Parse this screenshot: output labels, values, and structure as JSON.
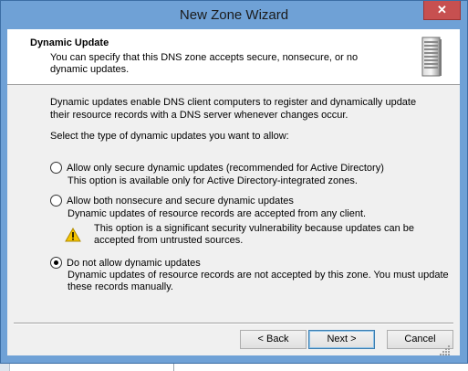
{
  "window": {
    "title": "New Zone Wizard",
    "close_glyph": "✕"
  },
  "header": {
    "title": "Dynamic Update",
    "description": "You can specify that this DNS zone accepts secure, nonsecure, or no dynamic updates.",
    "icon": "server-icon"
  },
  "body": {
    "intro": "Dynamic updates enable DNS client computers to register and dynamically update their resource records with a DNS server whenever changes occur.",
    "prompt": "Select the type of dynamic updates you want to allow:"
  },
  "options": [
    {
      "label": "Allow only secure dynamic updates (recommended for Active Directory)",
      "description": "This option is available only for Active Directory-integrated zones.",
      "selected": false
    },
    {
      "label": "Allow both nonsecure and secure dynamic updates",
      "description": "Dynamic updates of resource records are accepted from any client.",
      "warning": "This option is a significant security vulnerability because updates can be accepted from untrusted sources.",
      "selected": false
    },
    {
      "label": "Do not allow dynamic updates",
      "description": "Dynamic updates of resource records are not accepted by this zone. You must update these records manually.",
      "selected": true
    }
  ],
  "buttons": {
    "back": "< Back",
    "next": "Next >",
    "cancel": "Cancel"
  },
  "colors": {
    "titlebar": "#6fa1d6",
    "close": "#c75050",
    "warning": "#f5c400"
  }
}
